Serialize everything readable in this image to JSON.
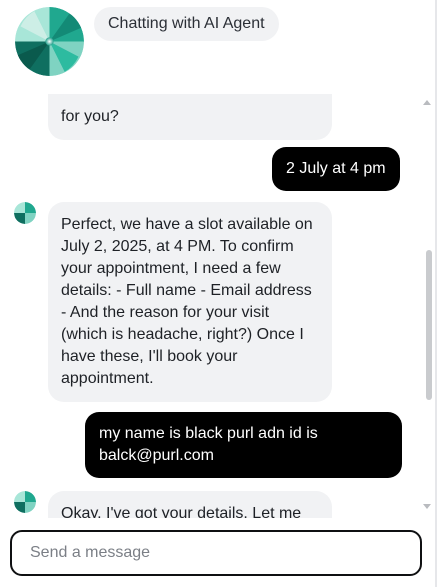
{
  "header": {
    "title": "Chatting with AI Agent",
    "logo_icon": "ai-agent-logo-icon"
  },
  "messages": [
    {
      "role": "bot",
      "text": "...ppointment for you?"
    },
    {
      "role": "user",
      "text": "2 July at 4 pm"
    },
    {
      "role": "bot",
      "text": "Perfect, we have a slot available on July 2, 2025, at 4 PM. To confirm your appointment, I need a few details: - Full name - Email address - And the reason for your visit (which is headache, right?) Once I have these, I'll book your appointment."
    },
    {
      "role": "user",
      "text": "my name is black purl adn id is balck@purl.com"
    },
    {
      "role": "bot",
      "text": "Okay, I've got your details. Let me"
    }
  ],
  "composer": {
    "placeholder": "Send a message"
  },
  "colors": {
    "bot_bubble": "#f1f2f4",
    "user_bubble": "#000000",
    "accent_teal": "#1f9e8a"
  }
}
